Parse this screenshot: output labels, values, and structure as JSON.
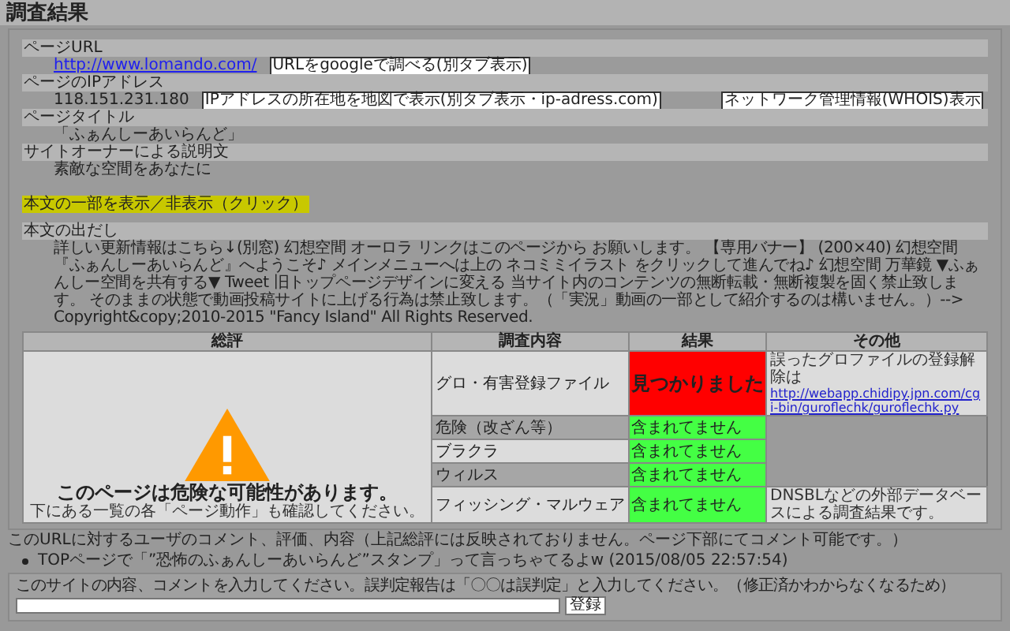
{
  "title": "調査結果",
  "fields": [
    {
      "label": "ページURL",
      "value": "http://www.lomando.com/",
      "kind": "link",
      "buttons": [
        "URLをgoogleで調べる(別タブ表示)"
      ]
    },
    {
      "label": "ページのIPアドレス",
      "value": "118.151.231.180",
      "kind": "text",
      "buttons": [
        "IPアドレスの所在地を地図で表示(別タブ表示・ip-adress.com)",
        "ネットワーク管理情報(WHOIS)表示"
      ]
    },
    {
      "label": "ページタイトル",
      "value": "「ふぁんしーあいらんど」",
      "kind": "text"
    },
    {
      "label": "サイトオーナーによる説明文",
      "value": "素敵な空間をあなたに",
      "kind": "text"
    }
  ],
  "toggle": "本文の一部を表示／非表示（クリック）",
  "excerpt": {
    "label": "本文の出だし",
    "text": "詳しい更新情報はこちら↓(別窓) 幻想空間 オーロラ リンクはこのページから お願いします。 【専用バナー】 (200×40) 幻想空間『ふぁんしーあいらんど』へようこそ♪ メインメニューへは上の ネコミミイラスト をクリックして進んでね♪ 幻想空間 万華鏡 ▼ふぁんしー空間を共有する▼ Tweet 旧トップページデザインに変える 当サイト内のコンテンツの無断転載・無断複製を固く禁止致します。 そのままの状態で動画投稿サイトに上げる行為は禁止致します。（「実況」動画の一部として紹介するのは構いません。）--> Copyright&copy;2010-2015 \"Fancy Island\" All Rights Reserved."
  },
  "table": {
    "columns": [
      "総評",
      "調査内容",
      "結果",
      "その他"
    ],
    "summary": {
      "headline": "このページは危険な可能性があります。",
      "note": "下にある一覧の各「ページ動作」も確認してください。"
    },
    "rows": [
      {
        "item": "グロ・有害登録ファイル",
        "result": "見つかりました",
        "color": "#ff0000",
        "other": "誤ったグロファイルの登録解除は ",
        "link": "http://webapp.chidipy.jpn.com/cgi-bin/guroflechk/guroflechk.py"
      },
      {
        "item": "危険（改ざん等）",
        "result": "含まれてません",
        "color": "#44ff44"
      },
      {
        "item": "ブラクラ",
        "result": "含まれてません",
        "color": "#44ff44"
      },
      {
        "item": "ウィルス",
        "result": "含まれてません",
        "color": "#44ff44"
      },
      {
        "item": "フィッシング・マルウェア",
        "result": "含まれてません",
        "color": "#44ff44",
        "other": "DNSBLなどの外部データベースによる調査結果です。"
      }
    ]
  },
  "comments_heading": "このURLに対するユーザのコメント、評価、内容（上記総評には反映されておりません。ページ下部にてコメント可能です。）",
  "comments": [
    "TOPページで「”恐怖のふぁんしーあいらんど”スタンプ」って言っちゃてるよw (2015/08/05 22:57:54)"
  ],
  "comment_form": {
    "prompt": "このサイトの内容、コメントを入力してください。誤判定報告は「〇〇は誤判定」と入力してください。（修正済かわからなくなるため）",
    "button": "登録"
  }
}
